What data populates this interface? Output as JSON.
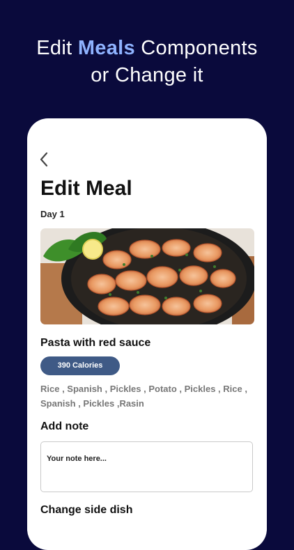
{
  "headline": {
    "before": "Edit ",
    "accent": "Meals",
    "after": " Components",
    "line2": "or Change it"
  },
  "screen": {
    "title": "Edit Meal",
    "day": "Day 1",
    "meal_name": "Pasta with red sauce",
    "calories": "390 Calories",
    "components_line1": "Rice , Spanish , Pickles , Potato , Pickles , Rice ,",
    "components_line2": "Spanish , Pickles ,Rasin",
    "note_label": "Add note",
    "note_placeholder": "Your note here...",
    "side_dish_label": "Change side dish"
  },
  "icons": {
    "back": "chevron-left-icon"
  },
  "colors": {
    "background": "#0a0a3c",
    "accent": "#8fb3ff",
    "badge": "#3f5a86"
  }
}
